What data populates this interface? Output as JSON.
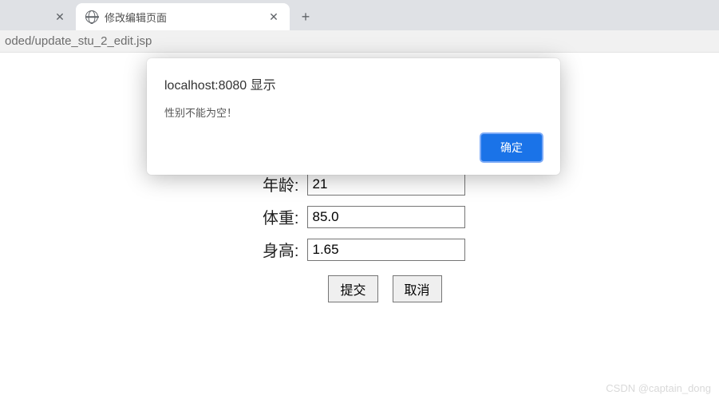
{
  "tabs": {
    "inactive_close": "✕",
    "active": {
      "title": "修改编辑页面",
      "close": "✕"
    },
    "new_tab": "+"
  },
  "url": "oded/update_stu_2_edit.jsp",
  "form": {
    "rows": [
      {
        "label": "年龄:",
        "value": "21"
      },
      {
        "label": "体重:",
        "value": "85.0"
      },
      {
        "label": "身高:",
        "value": "1.65"
      }
    ],
    "submit": "提交",
    "cancel": "取消"
  },
  "modal": {
    "title": "localhost:8080 显示",
    "message": "性别不能为空！",
    "ok": "确定"
  },
  "watermark": "CSDN @captain_dong"
}
